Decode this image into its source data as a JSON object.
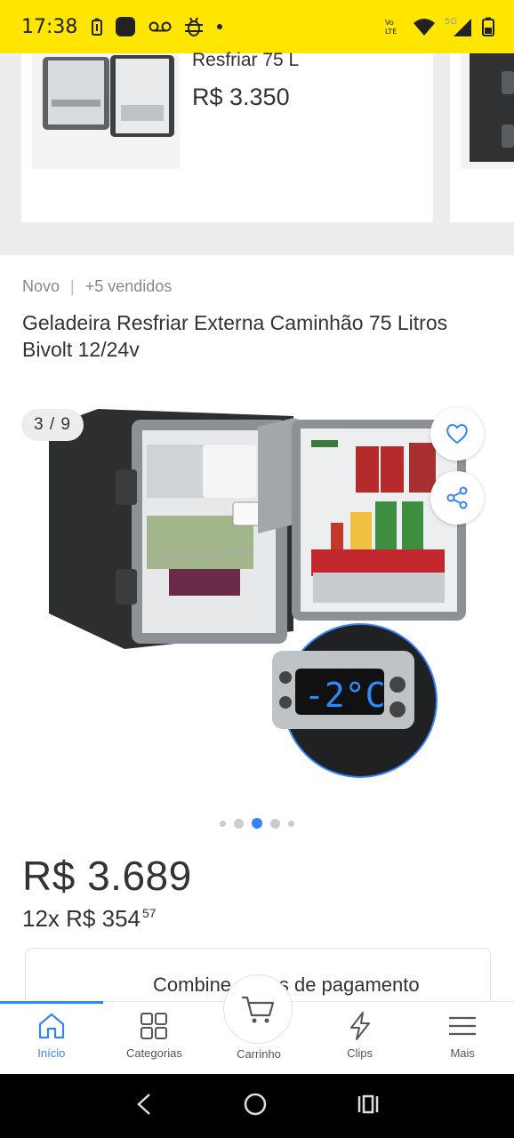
{
  "status_bar": {
    "time": "17:38",
    "network": "5G",
    "volte": "Vo LTE"
  },
  "related": {
    "title": "Resfriar 75 L",
    "price": "R$ 3.350"
  },
  "product": {
    "condition": "Novo",
    "sold": "+5 vendidos",
    "title": "Geladeira Resfriar Externa Caminhão 75 Litros Bivolt 12/24v",
    "gallery_counter": "3 / 9",
    "thermostat_display": "-2°C",
    "price": "R$ 3.689",
    "installments_prefix": "12x R$ 354",
    "installments_cents": "57",
    "payment_title": "Combine meios de pagamento"
  },
  "carousel": {
    "total_dots": 5,
    "active_index": 2
  },
  "bottom_nav": {
    "items": [
      {
        "label": "Início",
        "icon": "home-icon",
        "active": true
      },
      {
        "label": "Categorias",
        "icon": "grid-icon",
        "active": false
      },
      {
        "label": "Carrinho",
        "icon": "cart-icon",
        "active": false
      },
      {
        "label": "Clips",
        "icon": "lightning-icon",
        "active": false
      },
      {
        "label": "Mais",
        "icon": "menu-icon",
        "active": false
      }
    ]
  },
  "colors": {
    "brand_yellow": "#ffe600",
    "accent_blue": "#3483fa",
    "text_dark": "#333333",
    "text_muted": "#888888"
  }
}
